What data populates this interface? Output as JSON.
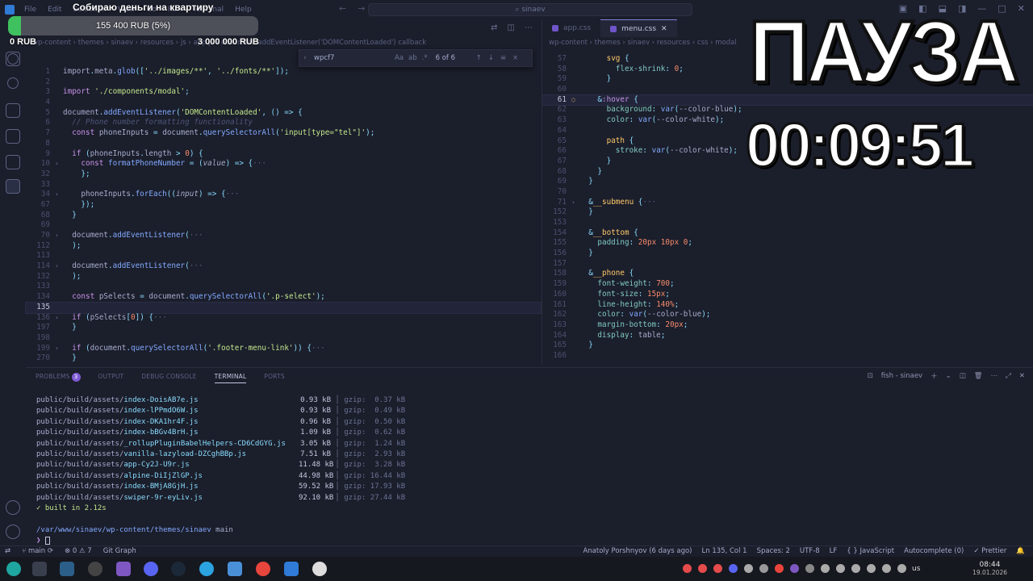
{
  "titlebar": {
    "menu": [
      "File",
      "Edit",
      "Selection",
      "View",
      "Go",
      "Run",
      "Terminal",
      "Help"
    ],
    "search": "sinaev",
    "nav_back": "←",
    "nav_forward": "→"
  },
  "donation": {
    "title": "Собираю деньги на квартиру",
    "amount": "155 400 RUB (5%)",
    "progress": 0.05,
    "min": "0 RUB",
    "goal": "3 000 000 RUB",
    "bar_color": "#3fc15f"
  },
  "overlay": {
    "pause": "ПАУЗА",
    "timer": "00:09:51"
  },
  "left_editor": {
    "breadcrumb": "wp-content › themes › sinaev › resources › js › app.js › document.addEventListener('DOMContentLoaded') callback",
    "find": {
      "query": "wpcf7",
      "options": [
        "Aa",
        "ab",
        ".*"
      ],
      "count": "6 of 6",
      "buttons": [
        "↑",
        "↓",
        "≡",
        "×"
      ]
    }
  },
  "right_editor": {
    "tabs": [
      {
        "label": "app.css",
        "active": false
      },
      {
        "label": "menu.css",
        "active": true
      }
    ],
    "breadcrumb": "wp-content › themes › sinaev › resources › css › modal"
  },
  "panel": {
    "tabs": [
      "PROBLEMS",
      "OUTPUT",
      "DEBUG CONSOLE",
      "TERMINAL",
      "PORTS"
    ],
    "problems_count": "3",
    "terminal_name": "fish - sinaev",
    "build_rows": [
      {
        "dir": "public/build/assets/",
        "file": "index-DoisAB7e.js",
        "size": "0.93 kB",
        "gzip": "gzip:  0.37 kB"
      },
      {
        "dir": "public/build/assets/",
        "file": "index-lPPmdO6W.js",
        "size": "0.93 kB",
        "gzip": "gzip:  0.49 kB"
      },
      {
        "dir": "public/build/assets/",
        "file": "index-DKA1hr4F.js",
        "size": "0.96 kB",
        "gzip": "gzip:  0.50 kB"
      },
      {
        "dir": "public/build/assets/",
        "file": "index-bBGv4BrH.js",
        "size": "1.09 kB",
        "gzip": "gzip:  0.62 kB"
      },
      {
        "dir": "public/build/assets/",
        "file": "_rollupPluginBabelHelpers-CD6CdGYG.js",
        "size": "3.05 kB",
        "gzip": "gzip:  1.24 kB"
      },
      {
        "dir": "public/build/assets/",
        "file": "vanilla-lazyload-DZCghBBp.js",
        "size": "7.51 kB",
        "gzip": "gzip:  2.93 kB"
      },
      {
        "dir": "public/build/assets/",
        "file": "app-Cy2J-U9r.js",
        "size": "11.48 kB",
        "gzip": "gzip:  3.28 kB"
      },
      {
        "dir": "public/build/assets/",
        "file": "alpine-DiIjZlGP.js",
        "size": "44.98 kB",
        "gzip": "gzip: 16.44 kB"
      },
      {
        "dir": "public/build/assets/",
        "file": "index-BMjA8GjH.js",
        "size": "59.52 kB",
        "gzip": "gzip: 17.93 kB"
      },
      {
        "dir": "public/build/assets/",
        "file": "swiper-9r-eyLiv.js",
        "size": "92.10 kB",
        "gzip": "gzip: 27.44 kB"
      }
    ],
    "built": "✓ built in 2.12s",
    "cwd": "/var/www/sinaev/wp-content/themes/sinaev",
    "branch": "main",
    "prompt": "❯"
  },
  "statusbar": {
    "branch": "main",
    "problems": "⊗ 0 ⚠ 7",
    "git_graph": "Git Graph",
    "blame": "Anatoly Porshnyov (6 days ago)",
    "position": "Ln 135, Col 1",
    "spaces": "Spaces: 2",
    "encoding": "UTF-8",
    "eol": "LF",
    "language": "{ } JavaScript",
    "autocomplete": "Autocomplete (0)",
    "prettier": "✓ Prettier"
  },
  "taskbar": {
    "lang": "us",
    "time": "08:44",
    "date": "19.01.2026"
  }
}
